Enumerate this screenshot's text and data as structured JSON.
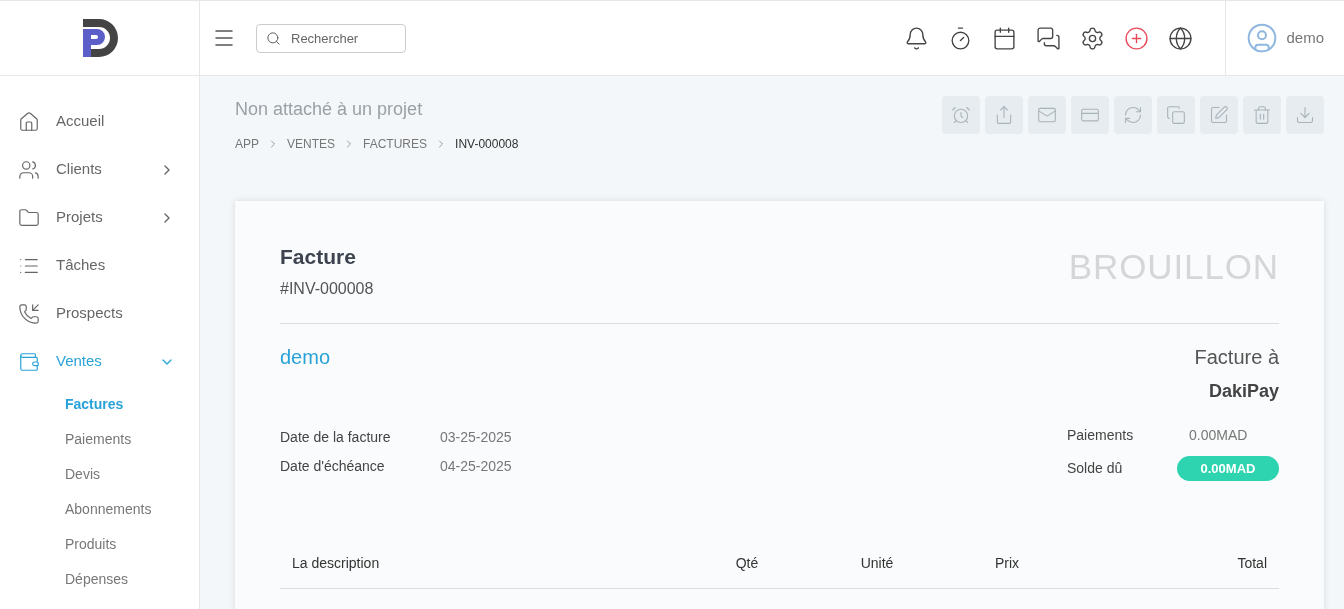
{
  "header": {
    "search": {
      "placeholder": "Rechercher"
    },
    "user": {
      "name": "demo"
    }
  },
  "sidebar": {
    "items": [
      {
        "label": "Accueil",
        "selected": false
      },
      {
        "label": "Clients",
        "selected": false,
        "expanded": false
      },
      {
        "label": "Projets",
        "selected": false,
        "expanded": false
      },
      {
        "label": "Tâches",
        "selected": false
      },
      {
        "label": "Prospects",
        "selected": false
      },
      {
        "label": "Ventes",
        "selected": true,
        "expanded": true,
        "children": [
          {
            "label": "Factures",
            "selected": true
          },
          {
            "label": "Paiements",
            "selected": false
          },
          {
            "label": "Devis",
            "selected": false
          },
          {
            "label": "Abonnements",
            "selected": false
          },
          {
            "label": "Produits",
            "selected": false
          },
          {
            "label": "Dépenses",
            "selected": false
          }
        ]
      }
    ]
  },
  "page": {
    "project": "Non attaché à un projet",
    "breadcrumb": [
      "APP",
      "VENTES",
      "FACTURES",
      "INV-000008"
    ]
  },
  "invoice": {
    "title": "Facture",
    "number": "#INV-000008",
    "status": "BROUILLON",
    "company": "demo",
    "bill_to_label": "Facture à",
    "client": "DakiPay",
    "dates": [
      {
        "label": "Date de la facture",
        "value": "03-25-2025"
      },
      {
        "label": "Date d'échéance",
        "value": "04-25-2025"
      }
    ],
    "payments": {
      "label": "Paiements",
      "value": "0.00MAD"
    },
    "balance": {
      "label": "Solde dû",
      "value": "0.00MAD"
    },
    "table": {
      "columns": [
        "La description",
        "Qté",
        "Unité",
        "Prix",
        "Total"
      ]
    }
  }
}
